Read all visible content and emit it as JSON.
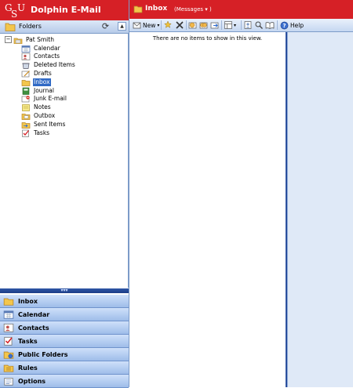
{
  "app": {
    "title": "Dolphin E-Mail",
    "logo_text": "GSU",
    "brand_color": "#d62026"
  },
  "folders_pane": {
    "header": "Folders",
    "refresh_icon": "refresh-icon",
    "collapse_icon": "chevron-up-icon",
    "root": "Pat Smith",
    "items": [
      {
        "label": "Calendar",
        "icon": "calendar-icon"
      },
      {
        "label": "Contacts",
        "icon": "contacts-icon"
      },
      {
        "label": "Deleted Items",
        "icon": "deleted-items-icon"
      },
      {
        "label": "Drafts",
        "icon": "drafts-icon"
      },
      {
        "label": "Inbox",
        "icon": "inbox-icon",
        "selected": true
      },
      {
        "label": "Journal",
        "icon": "journal-icon"
      },
      {
        "label": "Junk E-mail",
        "icon": "junk-email-icon"
      },
      {
        "label": "Notes",
        "icon": "notes-icon"
      },
      {
        "label": "Outbox",
        "icon": "outbox-icon"
      },
      {
        "label": "Sent Items",
        "icon": "sent-items-icon"
      },
      {
        "label": "Tasks",
        "icon": "tasks-icon"
      }
    ]
  },
  "nav_buttons": [
    {
      "label": "Inbox",
      "icon": "inbox-icon"
    },
    {
      "label": "Calendar",
      "icon": "calendar-icon"
    },
    {
      "label": "Contacts",
      "icon": "contacts-icon"
    },
    {
      "label": "Tasks",
      "icon": "tasks-icon"
    },
    {
      "label": "Public Folders",
      "icon": "public-folders-icon"
    },
    {
      "label": "Rules",
      "icon": "rules-icon"
    },
    {
      "label": "Options",
      "icon": "options-icon"
    }
  ],
  "view": {
    "folder_title": "Inbox",
    "view_label": "(Messages",
    "view_chevron": "▾",
    "view_close": ")"
  },
  "toolbar": {
    "new_label": "New",
    "help_label": "Help"
  },
  "message_list": {
    "empty_text": "There are no items to show in this view."
  }
}
